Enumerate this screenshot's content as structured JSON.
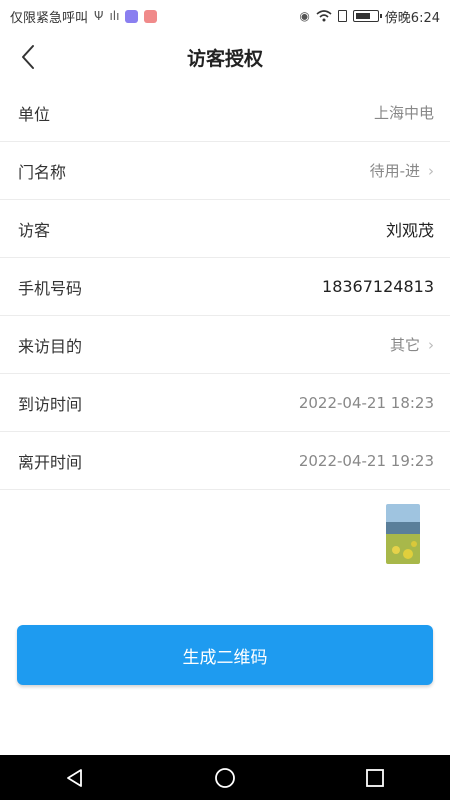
{
  "status_bar": {
    "carrier": "仅限紧急呼叫",
    "time": "傍晚6:24",
    "icons": [
      "usb-icon",
      "signal-icon",
      "app-icon",
      "app-icon-2",
      "eye-icon",
      "wifi-icon",
      "sim-icon",
      "battery-icon"
    ]
  },
  "header": {
    "title": "访客授权",
    "back_icon": "chevron-left-icon"
  },
  "form": {
    "rows": [
      {
        "label": "单位",
        "value": "上海中电",
        "chevron": false
      },
      {
        "label": "门名称",
        "value": "待用-进",
        "chevron": true
      },
      {
        "label": "访客",
        "value": "刘观茂",
        "chevron": false
      },
      {
        "label": "手机号码",
        "value": "18367124813",
        "chevron": false
      },
      {
        "label": "来访目的",
        "value": "其它",
        "chevron": true
      },
      {
        "label": "到访时间",
        "value": "2022-04-21 18:23",
        "chevron": false
      },
      {
        "label": "离开时间",
        "value": "2022-04-21 19:23",
        "chevron": false
      }
    ]
  },
  "button": {
    "generate_label": "生成二维码"
  },
  "colors": {
    "primary": "#1e9bf0",
    "text": "#333333",
    "muted": "#888888",
    "divider": "#ececec"
  },
  "nav": {
    "icons": [
      "back-triangle-icon",
      "home-circle-icon",
      "recent-square-icon"
    ]
  }
}
